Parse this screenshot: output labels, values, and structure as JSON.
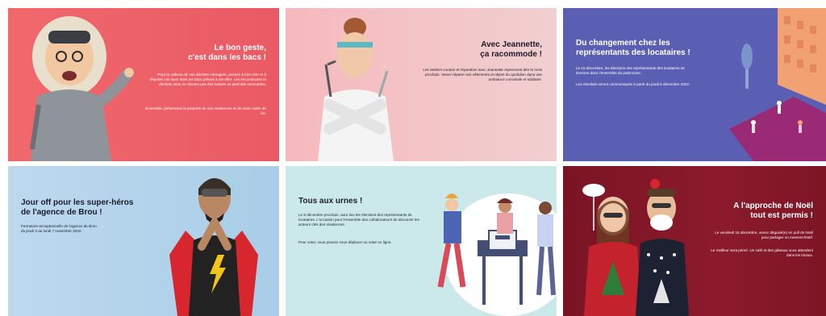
{
  "cards": [
    {
      "title_line1": "Le bon geste,",
      "title_line2": "c'est dans les bacs !",
      "desc1": "Pour la collecte de vos déchets ménagers, pensez à bien trier et à déposer vos sacs dans les bacs prévus à cet effet. Les encombrants et déchets verts ne doivent pas être laissés au pied des immeubles.",
      "desc2": "Ensemble, préservons la propreté de nos résidences et de notre cadre de vie."
    },
    {
      "title_line1": "Avec Jeannette,",
      "title_line2": "ça racommode !",
      "desc1": "Les ateliers couture et réparation avec Jeannette reprennent dès le mois prochain. Venez réparer vos vêtements et objets du quotidien dans une ambiance conviviale et solidaire."
    },
    {
      "title_line1": "Du changement chez les",
      "title_line2": "représentants des locataires !",
      "desc1": "Le 15 décembre, les élections des représentants des locataires se tiennent dans l'ensemble du patrimoine.",
      "desc2": "Les résultats seront communiqués à partir du jeudi 8 décembre 2022."
    },
    {
      "title_line1": "Jour off pour les super-héros",
      "title_line2": "de l'agence de Brou !",
      "desc1": "Fermeture exceptionnelle de l'agence de Brou",
      "desc2": "du jeudi 3 au lundi 7 novembre 2022."
    },
    {
      "title_line1": "Tous aux urnes !",
      "desc1": "Le 8 décembre prochain, aura lieu les élections des représentants de locataires. L'occasion pour l'ensemble des collaborateurs de découvrir les acteurs clés des résidences.",
      "desc2": "Pour voter, vous pouvez vous déplacer ou voter en ligne."
    },
    {
      "title_line1": "A l'approche de Noël",
      "title_line2": "tout est permis !",
      "desc1": "Le vendredi 16 décembre, venez déguisé(e) en pull de Noël pour partager un moment festif.",
      "desc2": "Le meilleur sera primé. Un café et des gâteaux vous attendent dans les locaux."
    }
  ],
  "colors": {
    "coral": "#f0686c",
    "pink": "#f3c6c8",
    "indigo": "#5b5fb4",
    "sky": "#a9cde7",
    "mint": "#cbe9ea",
    "burgundy": "#7f1526"
  }
}
